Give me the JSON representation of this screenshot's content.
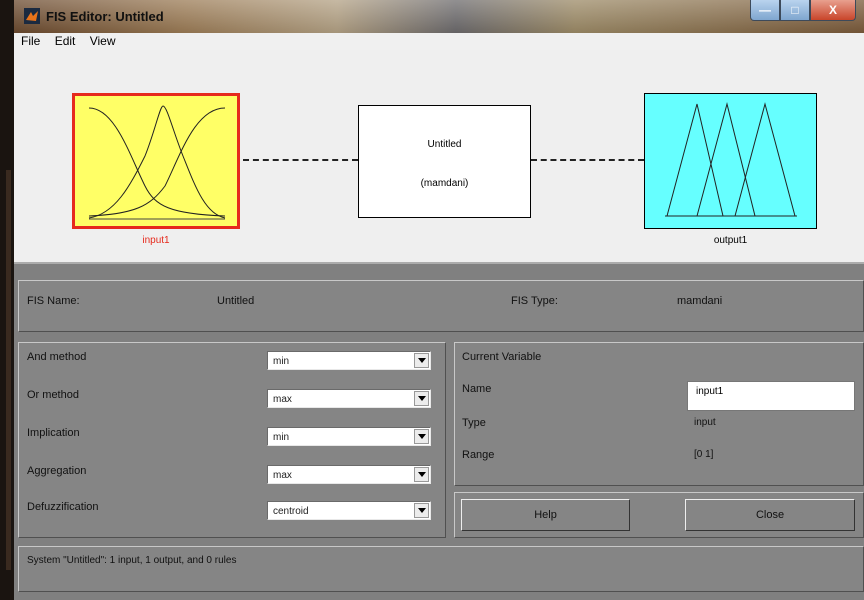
{
  "window": {
    "title": "FIS Editor: Untitled",
    "min_label": "—",
    "max_label": "□",
    "close_label": "X"
  },
  "menu": [
    "File",
    "Edit",
    "View"
  ],
  "diagram": {
    "input_label": "input1",
    "system_name": "Untitled",
    "system_type": "(mamdani)",
    "output_label": "output1"
  },
  "fis": {
    "name_label": "FIS Name:",
    "name_value": "Untitled",
    "type_label": "FIS Type:",
    "type_value": "mamdani"
  },
  "methods": [
    {
      "label": "And method",
      "value": "min"
    },
    {
      "label": "Or method",
      "value": "max"
    },
    {
      "label": "Implication",
      "value": "min"
    },
    {
      "label": "Aggregation",
      "value": "max"
    },
    {
      "label": "Defuzzification",
      "value": "centroid"
    }
  ],
  "current_variable": {
    "title": "Current Variable",
    "name_label": "Name",
    "name_value": "input1",
    "type_label": "Type",
    "type_value": "input",
    "range_label": "Range",
    "range_value": "[0 1]"
  },
  "buttons": {
    "help": "Help",
    "close": "Close"
  },
  "status": "System \"Untitled\": 1 input, 1 output, and 0 rules",
  "colors": {
    "input_box": "#ffff66",
    "input_border": "#e62a1d",
    "output_box": "#66ffff",
    "panel": "#808080"
  }
}
